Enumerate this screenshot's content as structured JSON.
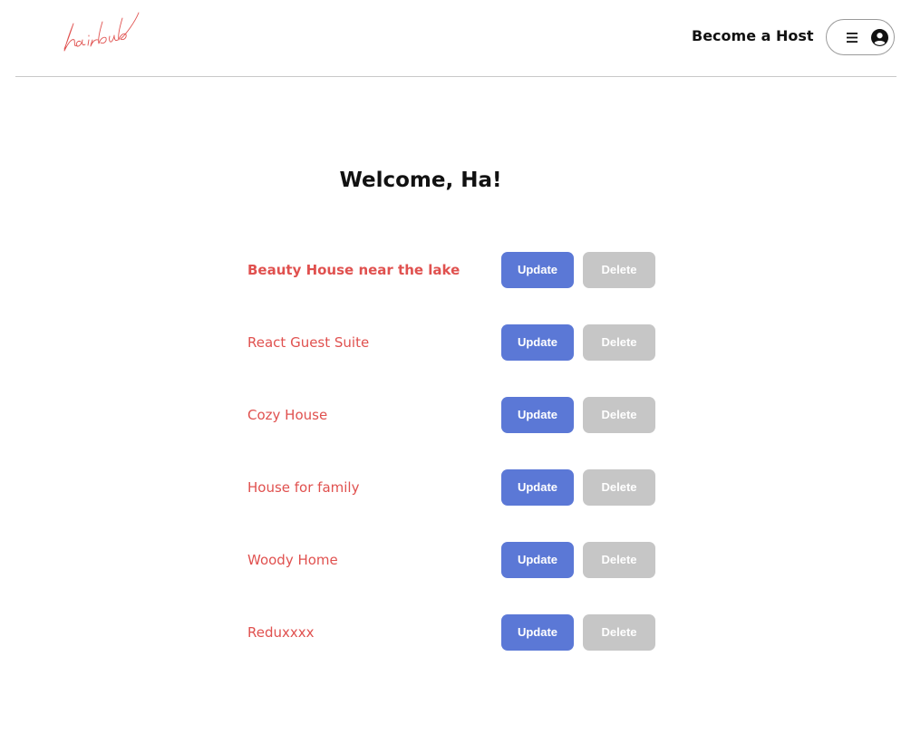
{
  "header": {
    "logo_text": "hairbnb",
    "become_host_label": "Become a Host"
  },
  "colors": {
    "accent": "#e0514f",
    "update_button": "#5b78d6",
    "delete_button": "#c6c6c6"
  },
  "welcome_text": "Welcome, Ha!",
  "listings": [
    {
      "name": "Beauty House near the lake",
      "update_label": "Update",
      "delete_label": "Delete"
    },
    {
      "name": "React Guest Suite",
      "update_label": "Update",
      "delete_label": "Delete"
    },
    {
      "name": "Cozy House",
      "update_label": "Update",
      "delete_label": "Delete"
    },
    {
      "name": "House for family",
      "update_label": "Update",
      "delete_label": "Delete"
    },
    {
      "name": "Woody Home",
      "update_label": "Update",
      "delete_label": "Delete"
    },
    {
      "name": "Reduxxxx",
      "update_label": "Update",
      "delete_label": "Delete"
    }
  ],
  "icons": {
    "menu": "hamburger-icon",
    "user": "user-circle-icon"
  }
}
